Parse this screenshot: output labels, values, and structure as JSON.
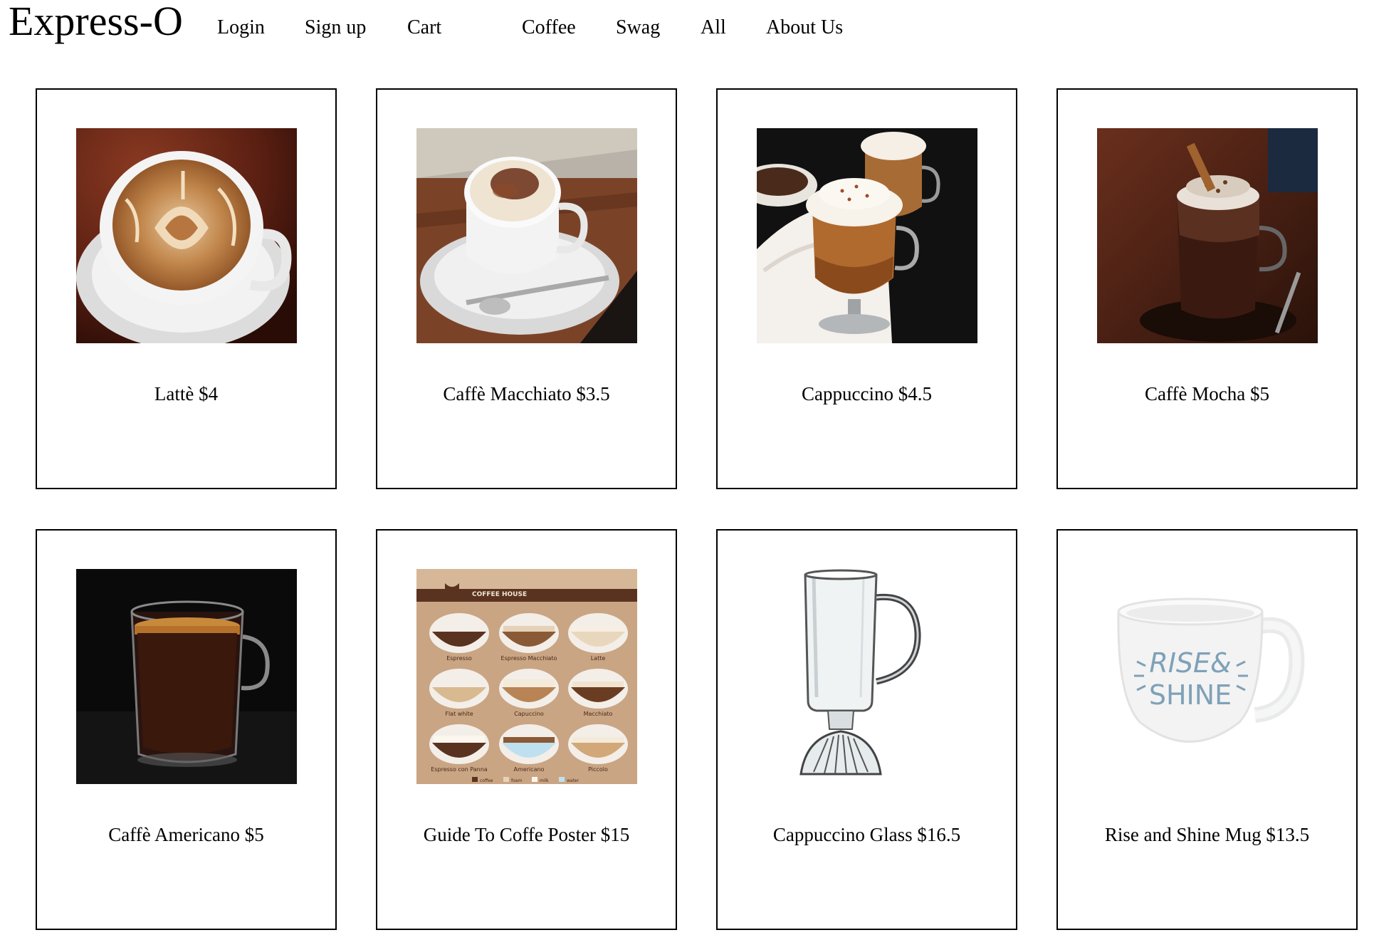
{
  "header": {
    "brand": "Express-O",
    "nav": [
      "Login",
      "Sign up",
      "Cart",
      "Coffee",
      "Swag",
      "All",
      "About Us"
    ]
  },
  "products": [
    {
      "caption": "Lattè $4",
      "icon": "latte-image"
    },
    {
      "caption": "Caffè Macchiato $3.5",
      "icon": "macchiato-image"
    },
    {
      "caption": "Cappuccino $4.5",
      "icon": "cappuccino-image"
    },
    {
      "caption": "Caffè Mocha $5",
      "icon": "mocha-image"
    },
    {
      "caption": "Caffè Americano $5",
      "icon": "americano-image"
    },
    {
      "caption": "Guide To Coffe Poster $15",
      "icon": "coffee-guide-poster-image"
    },
    {
      "caption": "Cappuccino Glass $16.5",
      "icon": "cappuccino-glass-image"
    },
    {
      "caption": "Rise and Shine Mug $13.5",
      "icon": "rise-and-shine-mug-image"
    }
  ],
  "poster": {
    "title": "COFFEE HOUSE",
    "drinks": [
      "Espresso",
      "Espresso Macchiato",
      "Latte",
      "Flat white",
      "Capuccino",
      "Macchiato",
      "Espresso con Panna",
      "Americano",
      "Piccolo"
    ],
    "legend": [
      "coffee",
      "foam",
      "milk",
      "water"
    ]
  },
  "mug": {
    "line1": "RISE&",
    "line2": "SHINE"
  }
}
